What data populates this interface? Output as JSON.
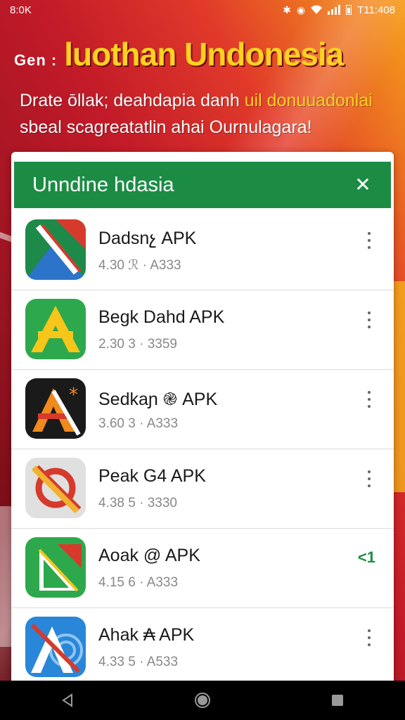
{
  "status_bar": {
    "time": "8:0K",
    "right_text": "T11:408",
    "icons": [
      "bluetooth-icon",
      "alarm-icon",
      "wifi-icon",
      "signal-icon",
      "battery-icon"
    ]
  },
  "banner": {
    "prefix": "Gen :",
    "title": "luothan Undonesia",
    "subtitle_line1_a": "Drate ōllak; deahdapia danh ",
    "subtitle_line1_b": "uil donuuadonlai",
    "subtitle_line2": "sbeal scagreatatlin ahai Ournulagara!"
  },
  "sheet": {
    "title": "Unndine hdasia",
    "close_icon": "close-icon"
  },
  "apps": [
    {
      "name": "Dadsnչ APK",
      "meta": "4.30 ℛ · A333",
      "action": "menu",
      "icon": "green-red-slash-app-icon",
      "colors": [
        "#1d8a4a",
        "#d63a2c"
      ]
    },
    {
      "name": "Begk Dahd APK",
      "meta": "2.30 3 · 3359",
      "action": "menu",
      "icon": "yellow-a-app-icon",
      "colors": [
        "#2ea84c",
        "#f6c61a"
      ]
    },
    {
      "name": "Sedkaɲ ֎ APK",
      "meta": "3.60 3 · A333",
      "action": "menu",
      "icon": "black-orange-a-app-icon",
      "colors": [
        "#1a1a1a",
        "#f08a1c"
      ]
    },
    {
      "name": "Peak G4 APK",
      "meta": "4.38 5 · 3330",
      "action": "menu",
      "icon": "grey-red-circle-app-icon",
      "colors": [
        "#e0e0e0",
        "#d63a2c"
      ]
    },
    {
      "name": "Aoak @ APK",
      "meta": "4.15 6 · A333",
      "action": "update",
      "badge": "<1",
      "icon": "green-triangle-app-icon",
      "colors": [
        "#2ea84c",
        "#d63a2c"
      ]
    },
    {
      "name": "Ahak ₳ APK",
      "meta": "4.33 5 · A533",
      "action": "menu",
      "icon": "blue-a-app-icon",
      "colors": [
        "#2a86d8",
        "#d63a2c"
      ]
    }
  ],
  "nav_bar": {
    "back_icon": "back-icon",
    "home_icon": "home-icon",
    "recents_icon": "recents-icon"
  }
}
